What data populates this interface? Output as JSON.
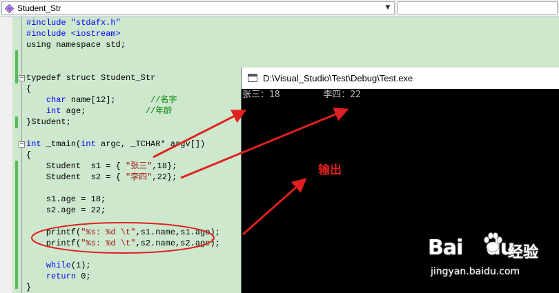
{
  "toolbar": {
    "scope_label": "Student_Str",
    "member_label": ""
  },
  "code": {
    "line1": "#include \"stdafx.h\"",
    "line2": "#include <iostream>",
    "line3": "using namespace std;",
    "line6": "typedef struct Student_Str",
    "line7": "{",
    "line8_type": "char",
    "line8_rest": " name[12];",
    "line8_comment": "//名字",
    "line9_type": "int",
    "line9_rest": " age;",
    "line9_comment": "//年龄",
    "line10": "}Student;",
    "line12_type": "int",
    "line12_rest": " _tmain(",
    "line12_type2": "int",
    "line12_rest2": " argc, _TCHAR* argv[])",
    "line13": "{",
    "line14_a": "    Student  s1 = { ",
    "line14_str": "\"张三\"",
    "line14_b": ",18};",
    "line15_a": "    Student  s2 = { ",
    "line15_str": "\"李四\"",
    "line15_b": ",22};",
    "line17": "    s1.age = 18;",
    "line18": "    s2.age = 22;",
    "line20_a": "    printf(",
    "line20_str": "\"%s: %d \\t\"",
    "line20_b": ",s1.name,s1.age);",
    "line21_a": "    printf(",
    "line21_str": "\"%s: %d \\t\"",
    "line21_b": ",s2.name,s2.age);",
    "line23_kw": "while",
    "line23_rest": "(1);",
    "line24_kw": "return",
    "line24_rest": " 0;",
    "line25": "}"
  },
  "console": {
    "title": "D:\\Visual_Studio\\Test\\Debug\\Test.exe",
    "output_1": "张三：18",
    "output_2": "李四：22"
  },
  "annotation": {
    "label": "输出",
    "color": "#e02020"
  },
  "watermark": {
    "brand": "Bai",
    "brand2": "du",
    "jingyan": "经验",
    "url": "jingyan.baidu.com"
  }
}
